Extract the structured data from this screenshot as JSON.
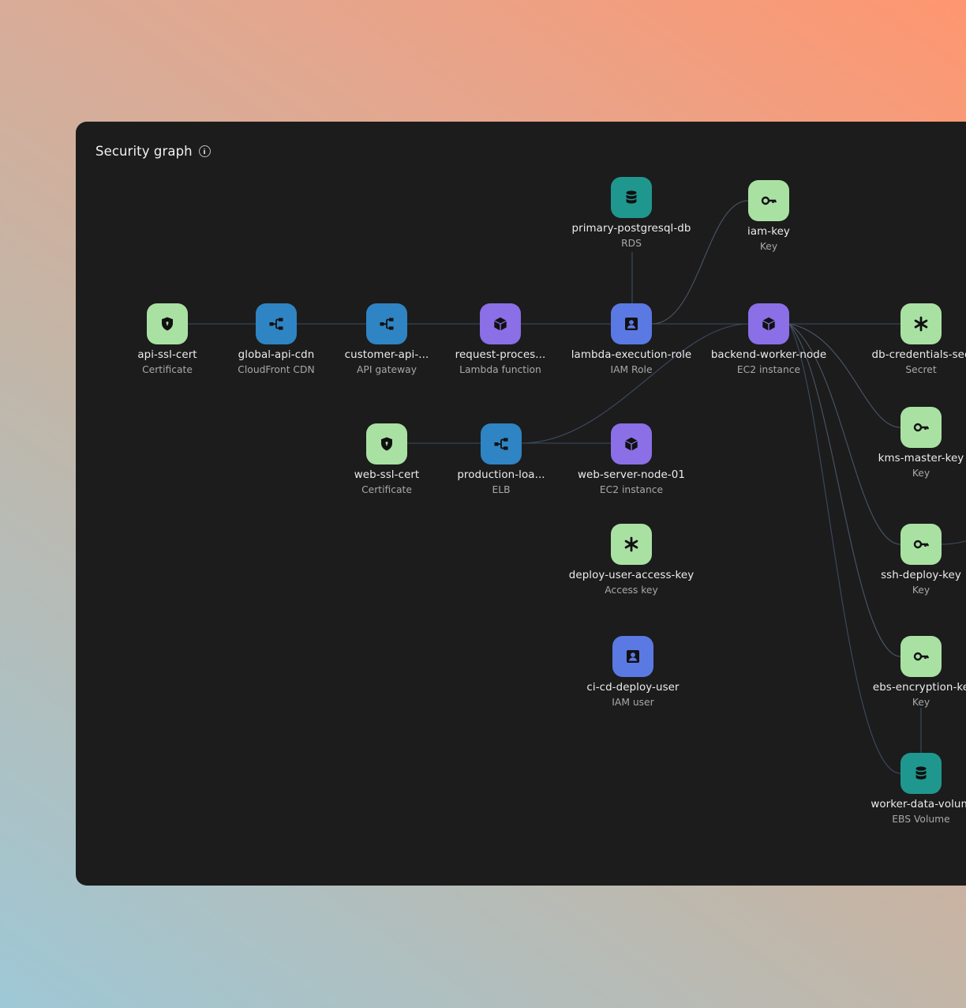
{
  "panel": {
    "title": "Security graph"
  },
  "colors": {
    "certificate": "#a9e1a3",
    "network": "#2f84c3",
    "compute": "#8a6fe6",
    "identity": "#5b79e3",
    "storage": "#1f978f",
    "edge": "#3d4b64"
  },
  "nodes": [
    {
      "name": "primary-postgresql-db",
      "type": "RDS",
      "icon": "database-icon"
    },
    {
      "name": "iam-key",
      "type": "Key",
      "icon": "key-icon"
    },
    {
      "name": "api-ssl-cert",
      "type": "Certificate",
      "icon": "shield-icon"
    },
    {
      "name": "global-api-cdn",
      "type": "CloudFront CDN",
      "icon": "network-icon"
    },
    {
      "name": "customer-api-...",
      "type": "API gateway",
      "icon": "network-icon"
    },
    {
      "name": "request-proces...",
      "type": "Lambda function",
      "icon": "cube-icon"
    },
    {
      "name": "lambda-execution-role",
      "type": "IAM Role",
      "icon": "user-badge-icon"
    },
    {
      "name": "backend-worker-node",
      "type": "EC2 instance",
      "icon": "cube-icon"
    },
    {
      "name": "db-credentials-sec",
      "type": "Secret",
      "icon": "asterisk-icon"
    },
    {
      "name": "kms-master-key",
      "type": "Key",
      "icon": "key-icon"
    },
    {
      "name": "web-ssl-cert",
      "type": "Certificate",
      "icon": "shield-icon"
    },
    {
      "name": "production-loa...",
      "type": "ELB",
      "icon": "network-icon"
    },
    {
      "name": "web-server-node-01",
      "type": "EC2 instance",
      "icon": "cube-icon"
    },
    {
      "name": "deploy-user-access-key",
      "type": "Access key",
      "icon": "asterisk-icon"
    },
    {
      "name": "ssh-deploy-key",
      "type": "Key",
      "icon": "key-icon"
    },
    {
      "name": "ci-cd-deploy-user",
      "type": "IAM user",
      "icon": "user-badge-icon"
    },
    {
      "name": "ebs-encryption-ke",
      "type": "Key",
      "icon": "key-icon"
    },
    {
      "name": "worker-data-volum",
      "type": "EBS Volume",
      "icon": "database-icon"
    }
  ]
}
